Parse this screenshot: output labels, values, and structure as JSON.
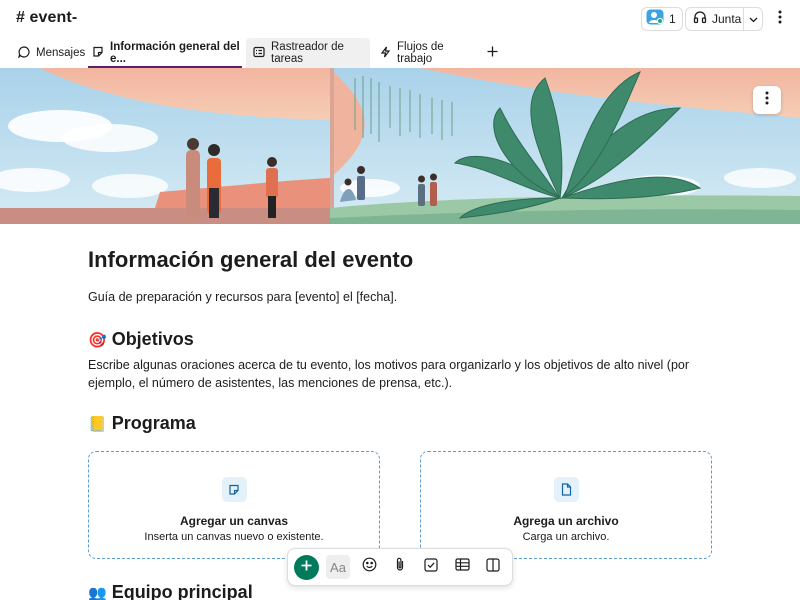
{
  "header": {
    "channel_title": "# event-",
    "member_count": "1",
    "huddle_label": "Junta"
  },
  "tabs": [
    {
      "label": "Mensajes",
      "icon": "message-icon"
    },
    {
      "label": "Información general del e...",
      "icon": "canvas-icon"
    },
    {
      "label": "Rastreador de tareas",
      "icon": "list-icon"
    },
    {
      "label": "Flujos de trabajo",
      "icon": "workflow-icon"
    }
  ],
  "page": {
    "title": "Información general del evento",
    "subtitle": "Guía de preparación y recursos para [evento] el [fecha].",
    "objectives": {
      "emoji": "🎯",
      "heading": "Objetivos",
      "text": "Escribe algunas oraciones acerca de tu evento, los motivos para organizarlo y los objetivos de alto nivel (por ejemplo, el número de asistentes, las menciones de prensa, etc.)."
    },
    "program": {
      "emoji": "📒",
      "heading": "Programa"
    },
    "team": {
      "emoji": "👥",
      "heading": "Equipo principal"
    },
    "cards": [
      {
        "title": "Agregar un canvas",
        "desc": "Inserta un canvas nuevo o existente.",
        "icon": "canvas-icon"
      },
      {
        "title": "Agrega un archivo",
        "desc": "Carga un archivo.",
        "icon": "file-icon"
      }
    ]
  },
  "toolbar": {
    "format_label": "Aa"
  },
  "colors": {
    "accent": "#611f69",
    "primary_green": "#007a5a",
    "card_border": "#5a9bd3"
  }
}
